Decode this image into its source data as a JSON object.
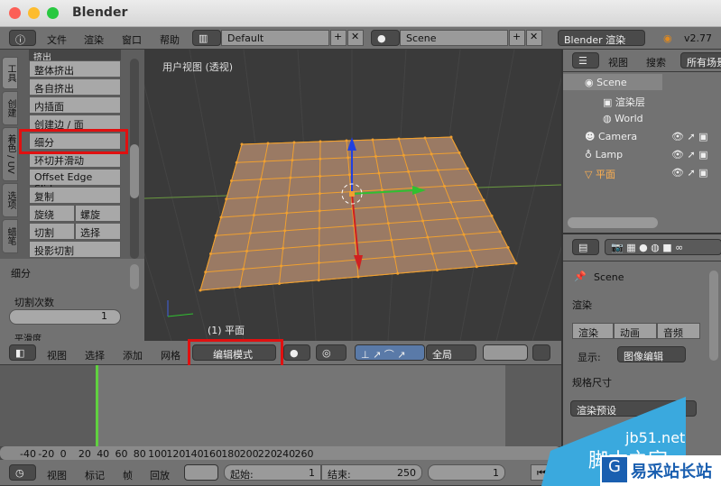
{
  "window": {
    "title": "Blender"
  },
  "top_header": {
    "menus": [
      "文件",
      "渲染",
      "窗口",
      "帮助"
    ],
    "layout": "Default",
    "scene": "Scene",
    "engine": "Blender 渲染",
    "version": "v2.77"
  },
  "tool_panel": {
    "tabs": [
      "工具",
      "创建",
      "着色 / UV",
      "选项",
      "蜡笔"
    ],
    "section": "挤出",
    "buttons": [
      "整体挤出",
      "各自挤出",
      "内插面",
      "创建边 / 面",
      "细分",
      "环切并滑动",
      "Offset Edge Slide",
      "复制"
    ],
    "pairs": [
      [
        "旋绕",
        "螺旋"
      ],
      [
        "切割",
        "选择"
      ]
    ],
    "last": "投影切割",
    "operator_title": "细分",
    "cuts_label": "切割次数",
    "cuts_value": "1",
    "smooth_label": "平滑度"
  },
  "viewport": {
    "label": "用户视图 (透视)",
    "object": "(1) 平面"
  },
  "view3d_header": {
    "menus": [
      "视图",
      "选择",
      "添加",
      "网格"
    ],
    "mode": "编辑模式",
    "orientation": "全局"
  },
  "outliner": {
    "menus": [
      "视图",
      "搜索"
    ],
    "filter": "所有场景",
    "items": [
      "Scene",
      "渲染层",
      "World",
      "Camera",
      "Lamp",
      "平面"
    ]
  },
  "properties": {
    "context": "Scene",
    "render_panel": "渲染",
    "render_btn": "渲染",
    "anim_btn": "动画",
    "audio_btn": "音频",
    "display_label": "显示:",
    "display_value": "图像编辑",
    "dims_panel": "规格尺寸",
    "preset": "渲染预设"
  },
  "timeline": {
    "ticks": [
      "-40",
      "-20",
      "0",
      "20",
      "40",
      "60",
      "80",
      "100",
      "120",
      "140",
      "160",
      "180",
      "200",
      "220",
      "240",
      "260"
    ],
    "menus": [
      "视图",
      "标记",
      "帧",
      "回放"
    ],
    "start_label": "起始:",
    "start": "1",
    "end_label": "结束:",
    "end": "250",
    "current": "1"
  },
  "watermark": {
    "text1": "jb51.net",
    "text2": "脚本之家",
    "text3": "易采站长站"
  },
  "colors": {
    "highlight": "#e01010",
    "mesh": "#f0a030",
    "current_frame": "#60d040"
  }
}
